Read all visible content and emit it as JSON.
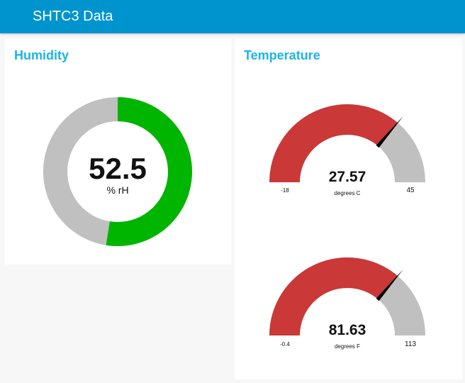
{
  "header": {
    "title": "SHTC3 Data"
  },
  "colors": {
    "header_bg": "#0094ce",
    "title_text": "#1bb4e8",
    "humidity_fill": "#00b500",
    "temperature_fill": "#ca3838",
    "gauge_track": "#c0c0c0",
    "needle": "#000000"
  },
  "humidity": {
    "title": "Humidity",
    "gauge": {
      "type": "donut",
      "value": 52.5,
      "value_text": "52.5",
      "unit": "% rH",
      "min": 0,
      "max": 100
    }
  },
  "temperature": {
    "title": "Temperature",
    "gauges": [
      {
        "type": "gauge",
        "value": 27.57,
        "value_text": "27.57",
        "unit": "degrees C",
        "min": -18,
        "max": 45,
        "min_label": "-18",
        "max_label": "45"
      },
      {
        "type": "gauge",
        "value": 81.63,
        "value_text": "81.63",
        "unit": "degrees F",
        "min": -0.4,
        "max": 113,
        "min_label": "-0.4",
        "max_label": "113"
      }
    ]
  }
}
